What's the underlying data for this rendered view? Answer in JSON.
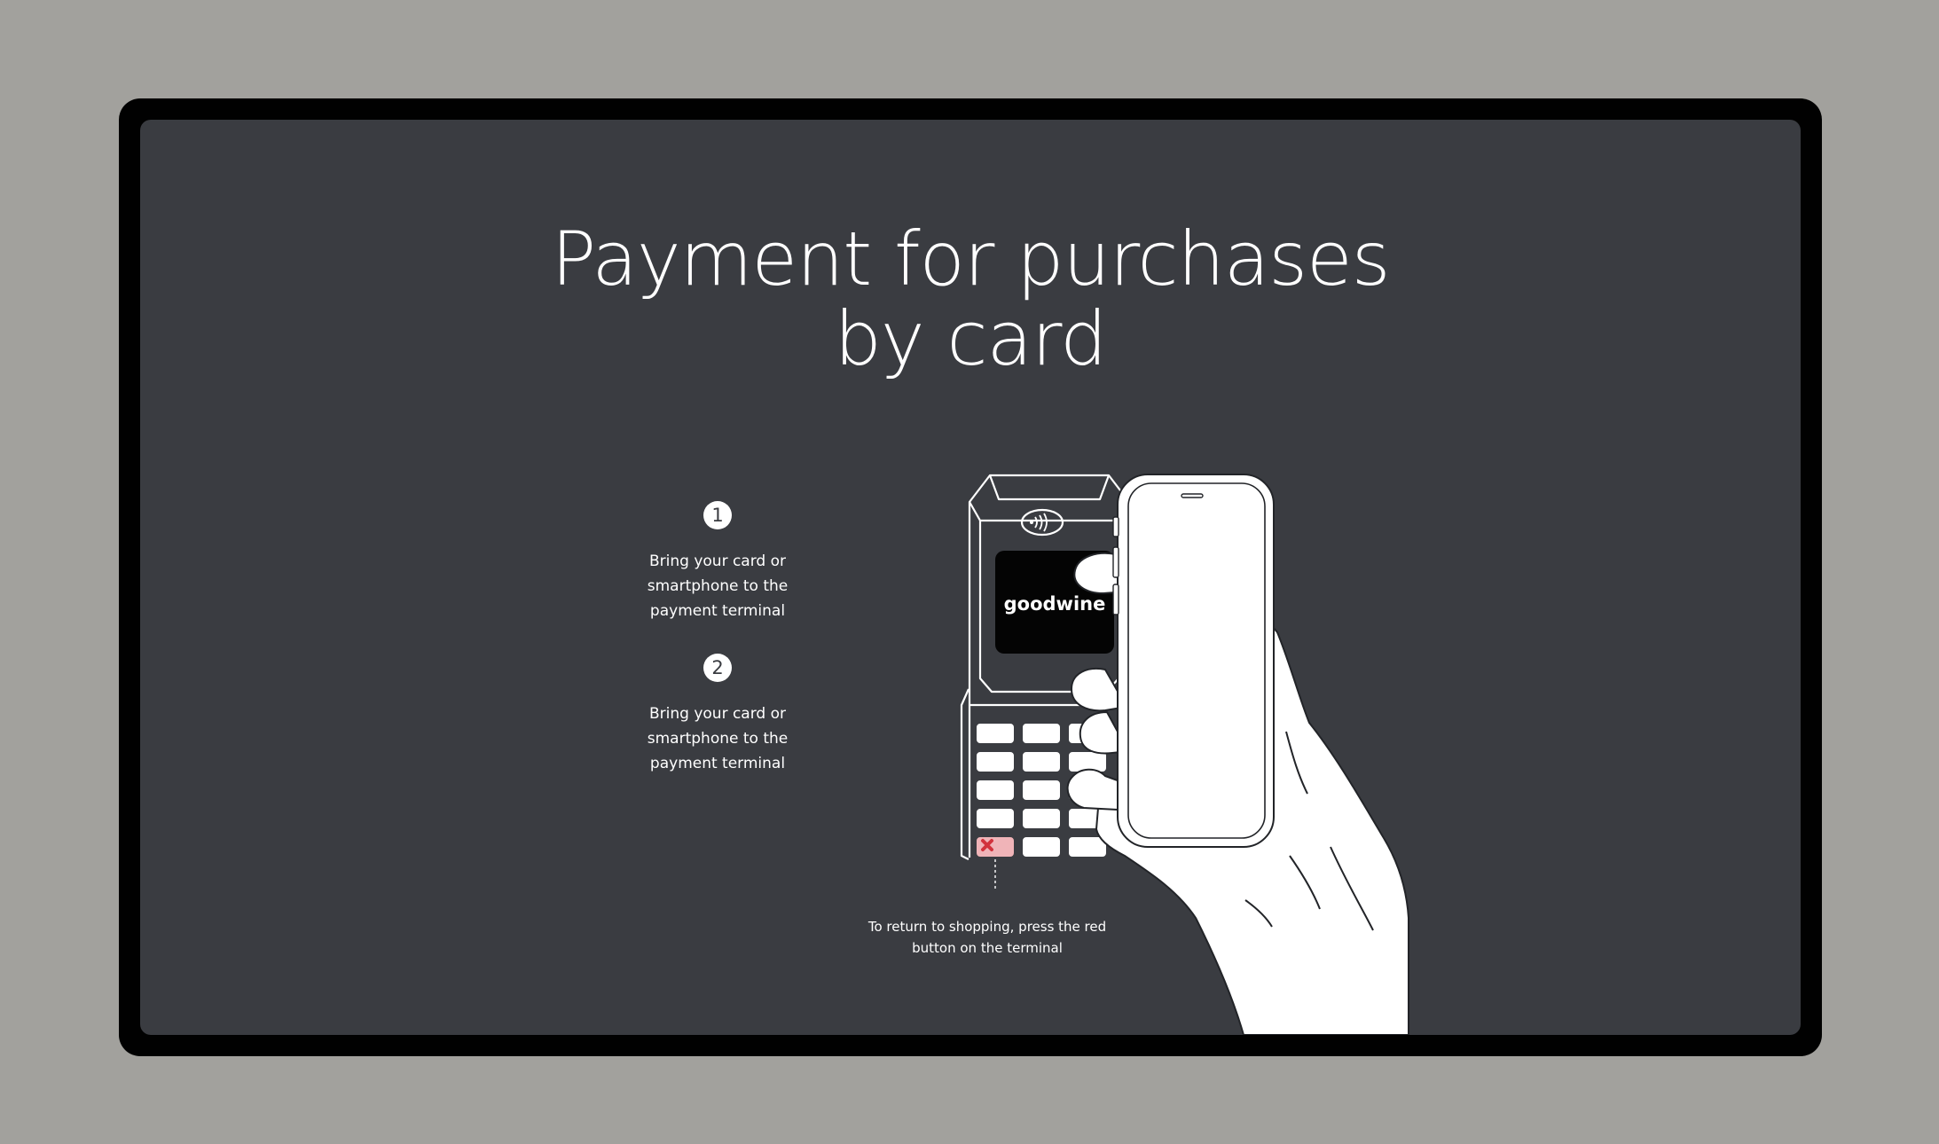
{
  "title": {
    "line1": "Payment for purchases",
    "line2": "by card"
  },
  "steps": [
    {
      "number": "1",
      "text": "Bring your card or smartphone to the payment terminal"
    },
    {
      "number": "2",
      "text": "Bring your card or smartphone to the payment terminal"
    }
  ],
  "terminal": {
    "brand": "goodwine",
    "cancel_key_color": "#f0b4b8",
    "cancel_mark_color": "#d2323c"
  },
  "hint": {
    "text": "To return to shopping, press the red button on the terminal"
  },
  "colors": {
    "background": "#a2a19d",
    "frame": "#010101",
    "screen": "#3a3c41",
    "text": "#ffffff"
  }
}
